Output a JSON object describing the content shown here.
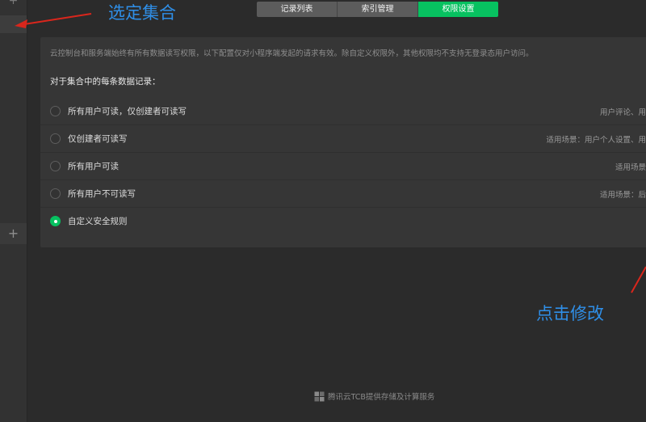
{
  "sidebar": {
    "plus_top": "+",
    "add_button": "+"
  },
  "tabs": [
    {
      "label": "记录列表",
      "active": false
    },
    {
      "label": "索引管理",
      "active": false
    },
    {
      "label": "权限设置",
      "active": true
    }
  ],
  "permissions": {
    "intro": "云控制台和服务端始终有所有数据读写权限，以下配置仅对小程序端发起的请求有效。除自定义权限外，其他权限均不支持无登录态用户访问。",
    "subtitle": "对于集合中的每条数据记录：",
    "options": [
      {
        "label": "所有用户可读，仅创建者可读写",
        "desc": "用户评论、用",
        "checked": false
      },
      {
        "label": "仅创建者可读写",
        "desc": "适用场景：用户个人设置、用",
        "checked": false
      },
      {
        "label": "所有用户可读",
        "desc": "适用场景",
        "checked": false
      },
      {
        "label": "所有用户不可读写",
        "desc": "适用场景：后",
        "checked": false
      },
      {
        "label": "自定义安全规则",
        "desc": "",
        "checked": true
      }
    ]
  },
  "annotations": {
    "select_collection": "选定集合",
    "click_modify": "点击修改",
    "color": "#2f8fe8"
  },
  "footer": {
    "text": "腾讯云TCB提供存储及计算服务",
    "icon": "tcb-logo-icon"
  },
  "colors": {
    "accent": "#07c160",
    "background": "#2b2b2b",
    "panel": "#363636"
  }
}
